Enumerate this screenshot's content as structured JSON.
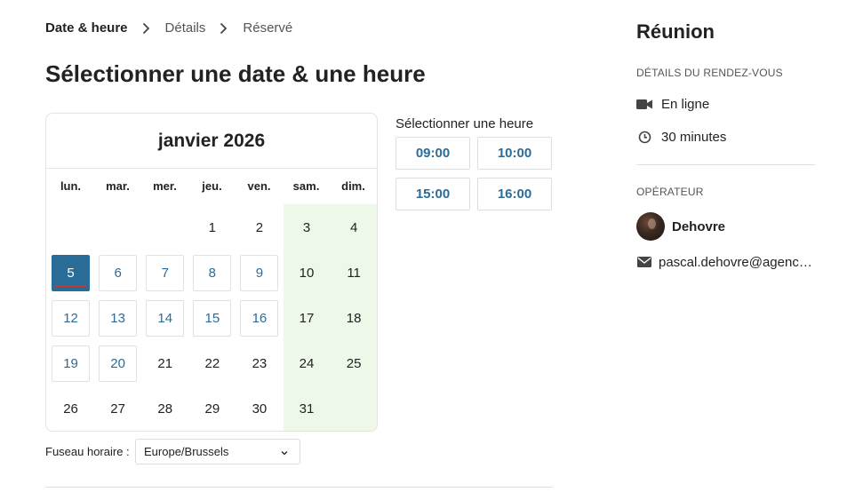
{
  "breadcrumb": {
    "step1": "Date & heure",
    "step2": "Détails",
    "step3": "Réservé"
  },
  "page_title": "Sélectionner une date & une heure",
  "calendar": {
    "month_label": "janvier 2026",
    "weekdays": [
      "lun.",
      "mar.",
      "mer.",
      "jeu.",
      "ven.",
      "sam.",
      "dim."
    ],
    "days": [
      {
        "label": "",
        "state": "empty"
      },
      {
        "label": "",
        "state": "empty"
      },
      {
        "label": "",
        "state": "empty"
      },
      {
        "label": "1",
        "state": "normal"
      },
      {
        "label": "2",
        "state": "normal"
      },
      {
        "label": "3",
        "state": "normal"
      },
      {
        "label": "4",
        "state": "normal"
      },
      {
        "label": "5",
        "state": "selected"
      },
      {
        "label": "6",
        "state": "available"
      },
      {
        "label": "7",
        "state": "available"
      },
      {
        "label": "8",
        "state": "available"
      },
      {
        "label": "9",
        "state": "available"
      },
      {
        "label": "10",
        "state": "normal"
      },
      {
        "label": "11",
        "state": "normal"
      },
      {
        "label": "12",
        "state": "available"
      },
      {
        "label": "13",
        "state": "available"
      },
      {
        "label": "14",
        "state": "available"
      },
      {
        "label": "15",
        "state": "available"
      },
      {
        "label": "16",
        "state": "available"
      },
      {
        "label": "17",
        "state": "normal"
      },
      {
        "label": "18",
        "state": "normal"
      },
      {
        "label": "19",
        "state": "available"
      },
      {
        "label": "20",
        "state": "available"
      },
      {
        "label": "21",
        "state": "normal"
      },
      {
        "label": "22",
        "state": "normal"
      },
      {
        "label": "23",
        "state": "normal"
      },
      {
        "label": "24",
        "state": "normal"
      },
      {
        "label": "25",
        "state": "normal"
      },
      {
        "label": "26",
        "state": "normal"
      },
      {
        "label": "27",
        "state": "normal"
      },
      {
        "label": "28",
        "state": "normal"
      },
      {
        "label": "29",
        "state": "normal"
      },
      {
        "label": "30",
        "state": "normal"
      },
      {
        "label": "31",
        "state": "normal"
      },
      {
        "label": "",
        "state": "empty"
      }
    ]
  },
  "timezone": {
    "label": "Fuseau horaire :",
    "value": "Europe/Brussels"
  },
  "times": {
    "heading": "Sélectionner une heure",
    "slots": [
      "09:00",
      "10:00",
      "15:00",
      "16:00"
    ]
  },
  "summary": {
    "title": "Réunion",
    "details_heading": "DÉTAILS DU RENDEZ-VOUS",
    "location": "En ligne",
    "duration": "30 minutes",
    "operator_heading": "OPÉRATEUR",
    "operator_name": "Dehovre",
    "operator_email": "pascal.dehovre@agenc…"
  },
  "colors": {
    "accent": "#2a6c98",
    "weekend_bg": "#eef8e9",
    "selected_underline": "#c0392b"
  },
  "icons": {
    "breadcrumb_sep": "chevron-right-icon",
    "location": "video-camera-icon",
    "duration": "clock-icon",
    "email": "envelope-icon",
    "timezone_dropdown": "chevron-down-icon"
  }
}
